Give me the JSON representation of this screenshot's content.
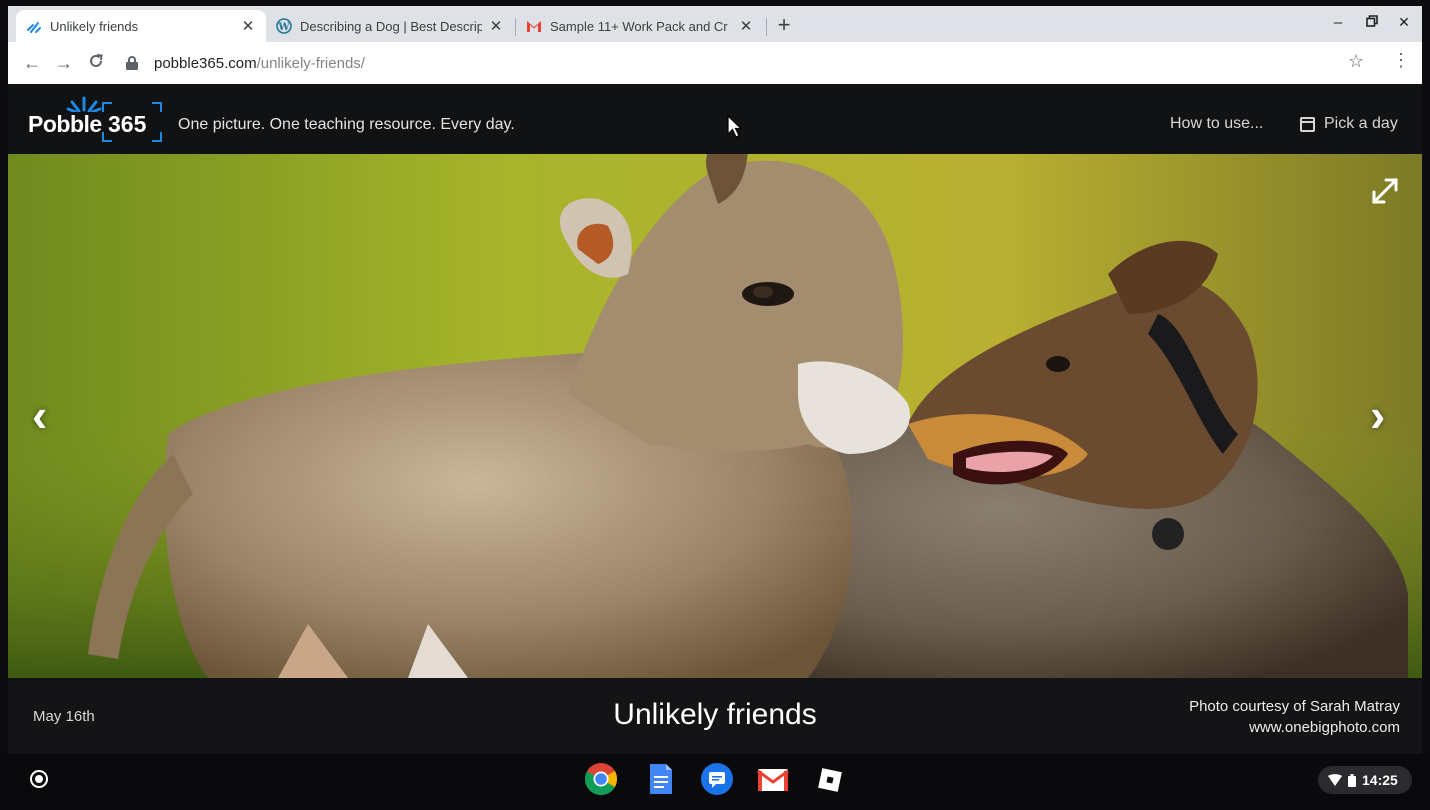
{
  "browser": {
    "tabs": [
      {
        "title": "Unlikely friends",
        "favicon": "pobble-icon",
        "active": true
      },
      {
        "title": "Describing a Dog | Best Descrip",
        "favicon": "wordpress-icon",
        "active": false
      },
      {
        "title": "Sample 11+ Work Pack and Cr",
        "favicon": "gmail-icon",
        "active": false
      }
    ],
    "url_host": "pobble365.com",
    "url_path": "/unlikely-friends/"
  },
  "site": {
    "logo_word": "Pobble",
    "logo_number": "365",
    "tagline": "One picture. One teaching resource. Every day.",
    "how_to_use": "How to use...",
    "pick_a_day": "Pick a day"
  },
  "picture": {
    "date": "May 16th",
    "title": "Unlikely friends",
    "credit_line1": "Photo courtesy of Sarah Matray",
    "credit_line2": "www.onebigphoto.com"
  },
  "shelf": {
    "apps": [
      "chrome-icon",
      "docs-icon",
      "messages-icon",
      "gmail-icon",
      "roblox-icon"
    ],
    "time": "14:25"
  },
  "colors": {
    "accent": "#1e88e5",
    "header_bg": "#111214",
    "caption_bg": "#141416"
  }
}
